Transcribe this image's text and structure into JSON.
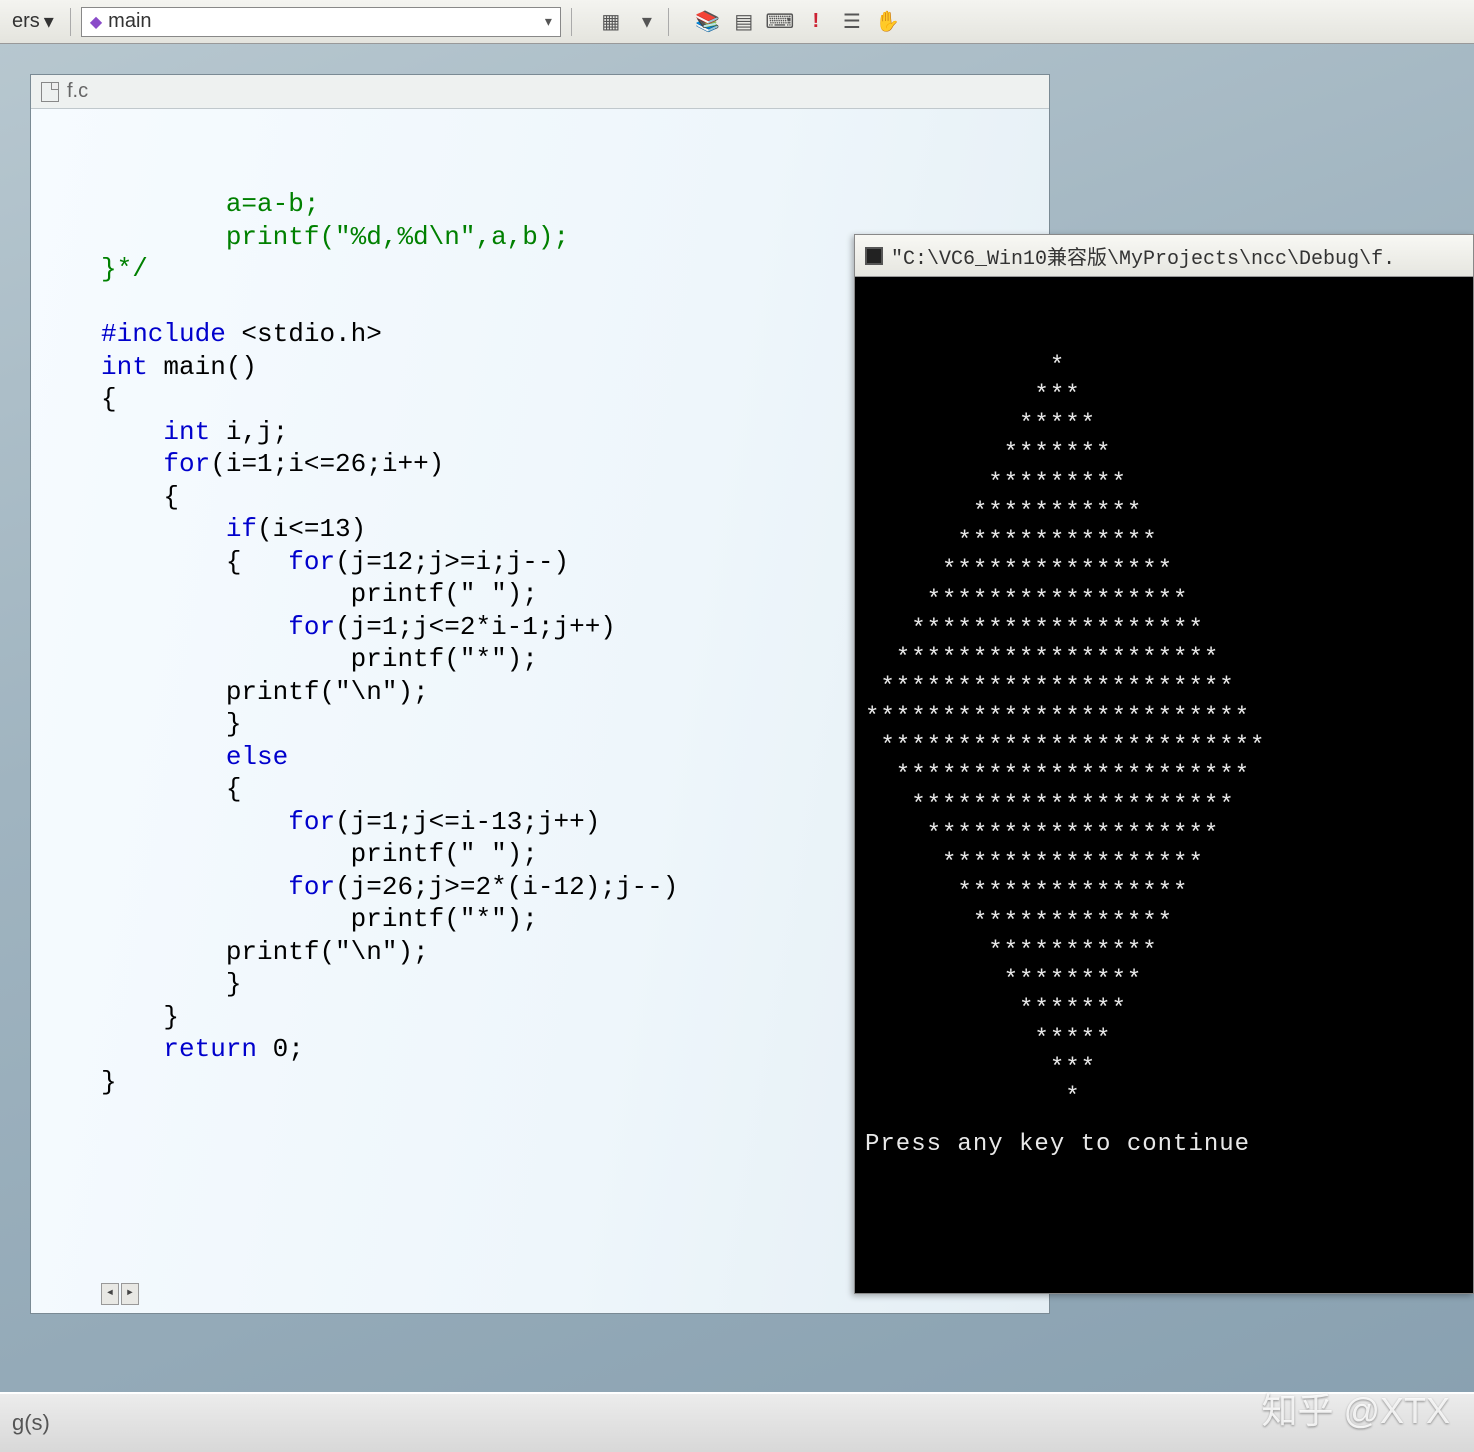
{
  "toolbar": {
    "left_dd": "ers",
    "combo_text": "main",
    "icons": [
      "layout",
      "caret",
      "books",
      "grid",
      "keyboard",
      "bang",
      "list",
      "hand"
    ]
  },
  "editor": {
    "filename": "f.c",
    "code_lines": [
      {
        "indent": 2,
        "segs": [
          {
            "t": "a=a-b;",
            "c": "cm"
          }
        ]
      },
      {
        "indent": 2,
        "segs": [
          {
            "t": "printf(\"%d,%d\\n\",a,b);",
            "c": "cm"
          }
        ]
      },
      {
        "indent": 0,
        "segs": [
          {
            "t": "}*/",
            "c": "cm"
          }
        ]
      },
      {
        "indent": 0,
        "segs": []
      },
      {
        "indent": 0,
        "segs": [
          {
            "t": "#include",
            "c": "pp"
          },
          {
            "t": " <stdio.h>",
            "c": "id"
          }
        ]
      },
      {
        "indent": 0,
        "segs": [
          {
            "t": "int",
            "c": "kw"
          },
          {
            "t": " main()",
            "c": "id"
          }
        ]
      },
      {
        "indent": 0,
        "segs": [
          {
            "t": "{",
            "c": "br"
          }
        ]
      },
      {
        "indent": 1,
        "segs": [
          {
            "t": "int",
            "c": "kw"
          },
          {
            "t": " i,j;",
            "c": "id"
          }
        ]
      },
      {
        "indent": 1,
        "segs": [
          {
            "t": "for",
            "c": "kw"
          },
          {
            "t": "(i=1;i<=26;i++)",
            "c": "id"
          }
        ]
      },
      {
        "indent": 1,
        "segs": [
          {
            "t": "{",
            "c": "br"
          }
        ]
      },
      {
        "indent": 2,
        "segs": [
          {
            "t": "if",
            "c": "kw"
          },
          {
            "t": "(i<=13)",
            "c": "id"
          }
        ]
      },
      {
        "indent": 2,
        "segs": [
          {
            "t": "{   ",
            "c": "br"
          },
          {
            "t": "for",
            "c": "kw"
          },
          {
            "t": "(j=12;j>=i;j--)",
            "c": "id"
          }
        ]
      },
      {
        "indent": 4,
        "segs": [
          {
            "t": "printf(\" \");",
            "c": "id"
          }
        ]
      },
      {
        "indent": 3,
        "segs": [
          {
            "t": "for",
            "c": "kw"
          },
          {
            "t": "(j=1;j<=2*i-1;j++)",
            "c": "id"
          }
        ]
      },
      {
        "indent": 4,
        "segs": [
          {
            "t": "printf(\"*\");",
            "c": "id"
          }
        ]
      },
      {
        "indent": 2,
        "segs": [
          {
            "t": "printf(\"\\n\");",
            "c": "id"
          }
        ]
      },
      {
        "indent": 2,
        "segs": [
          {
            "t": "}",
            "c": "br"
          }
        ]
      },
      {
        "indent": 2,
        "segs": [
          {
            "t": "else",
            "c": "kw"
          }
        ]
      },
      {
        "indent": 2,
        "segs": [
          {
            "t": "{",
            "c": "br"
          }
        ]
      },
      {
        "indent": 3,
        "segs": [
          {
            "t": "for",
            "c": "kw"
          },
          {
            "t": "(j=1;j<=i-13;j++)",
            "c": "id"
          }
        ]
      },
      {
        "indent": 4,
        "segs": [
          {
            "t": "printf(\" \");",
            "c": "id"
          }
        ]
      },
      {
        "indent": 3,
        "segs": [
          {
            "t": "for",
            "c": "kw"
          },
          {
            "t": "(j=26;j>=2*(i-12);j--)",
            "c": "id"
          }
        ]
      },
      {
        "indent": 4,
        "segs": [
          {
            "t": "printf(\"*\");",
            "c": "id"
          }
        ]
      },
      {
        "indent": 2,
        "segs": [
          {
            "t": "printf(\"\\n\");",
            "c": "id"
          }
        ]
      },
      {
        "indent": 2,
        "segs": [
          {
            "t": "}",
            "c": "br"
          }
        ]
      },
      {
        "indent": 1,
        "segs": [
          {
            "t": "}",
            "c": "br"
          }
        ]
      },
      {
        "indent": 1,
        "segs": [
          {
            "t": "return",
            "c": "kw"
          },
          {
            "t": " 0;",
            "c": "id"
          }
        ]
      },
      {
        "indent": 0,
        "segs": [
          {
            "t": "}",
            "c": "br"
          }
        ]
      }
    ],
    "indent_unit": "    "
  },
  "console": {
    "title": "\"C:\\VC6_Win10兼容版\\MyProjects\\ncc\\Debug\\f.",
    "diamond_rows": 26,
    "press_text": "Press any key to continue"
  },
  "status": {
    "text": "g(s)"
  },
  "watermark": "知乎 @XTX"
}
